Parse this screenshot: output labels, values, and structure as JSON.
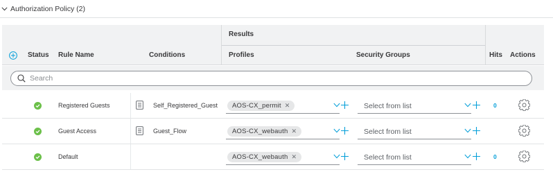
{
  "section": {
    "title": "Authorization Policy (2)"
  },
  "table": {
    "headers": {
      "status": "Status",
      "rule_name": "Rule Name",
      "conditions": "Conditions",
      "results": "Results",
      "profiles": "Profiles",
      "security_groups": "Security Groups",
      "hits": "Hits",
      "actions": "Actions"
    },
    "search": {
      "placeholder": "Search",
      "value": ""
    },
    "rows": [
      {
        "status": "enabled",
        "rule_name": "Registered Guests",
        "condition": "Self_Registered_Guest",
        "profile": "AOS-CX_permit",
        "security_group_placeholder": "Select from list",
        "hits": "0"
      },
      {
        "status": "enabled",
        "rule_name": "Guest Access",
        "condition": "Guest_Flow",
        "profile": "AOS-CX_webauth",
        "security_group_placeholder": "Select from list",
        "hits": ""
      },
      {
        "status": "enabled",
        "rule_name": "Default",
        "condition": "",
        "profile": "AOS-CX_webauth",
        "security_group_placeholder": "Select from list",
        "hits": "0"
      }
    ]
  },
  "colors": {
    "accent": "#049fd9",
    "status_enabled": "#6cc04a",
    "header_bg": "#f1f2f3",
    "chip_bg": "#e6e7e8"
  },
  "icons": {
    "collapse": "chevron-down-icon",
    "add_rule": "plus-circle-icon",
    "search": "search-icon",
    "status": "check-circle-icon",
    "condition": "document-icon",
    "chip_remove": "close-icon",
    "dropdown": "chevron-down-icon",
    "add": "plus-icon",
    "actions": "gear-icon"
  }
}
